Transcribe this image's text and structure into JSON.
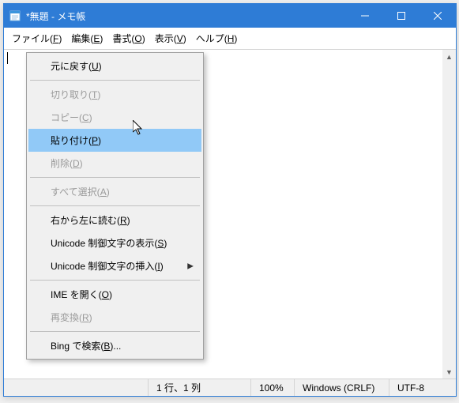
{
  "title": "*無題 - メモ帳",
  "menubar": {
    "file": "ファイル(F)",
    "edit": "編集(E)",
    "format": "書式(O)",
    "view": "表示(V)",
    "help": "ヘルプ(H)"
  },
  "context_menu": {
    "undo": "元に戻す(U)",
    "cut": "切り取り(T)",
    "copy": "コピー(C)",
    "paste": "貼り付け(P)",
    "delete": "削除(D)",
    "select_all": "すべて選択(A)",
    "rtl": "右から左に読む(R)",
    "show_unicode": "Unicode 制御文字の表示(S)",
    "insert_unicode": "Unicode 制御文字の挿入(I)",
    "open_ime": "IME を開く(O)",
    "reconvert": "再変換(R)",
    "bing_search": "Bing で検索(B)..."
  },
  "statusbar": {
    "position": "1 行、1 列",
    "zoom": "100%",
    "line_ending": "Windows (CRLF)",
    "encoding": "UTF-8"
  },
  "text_content": ""
}
